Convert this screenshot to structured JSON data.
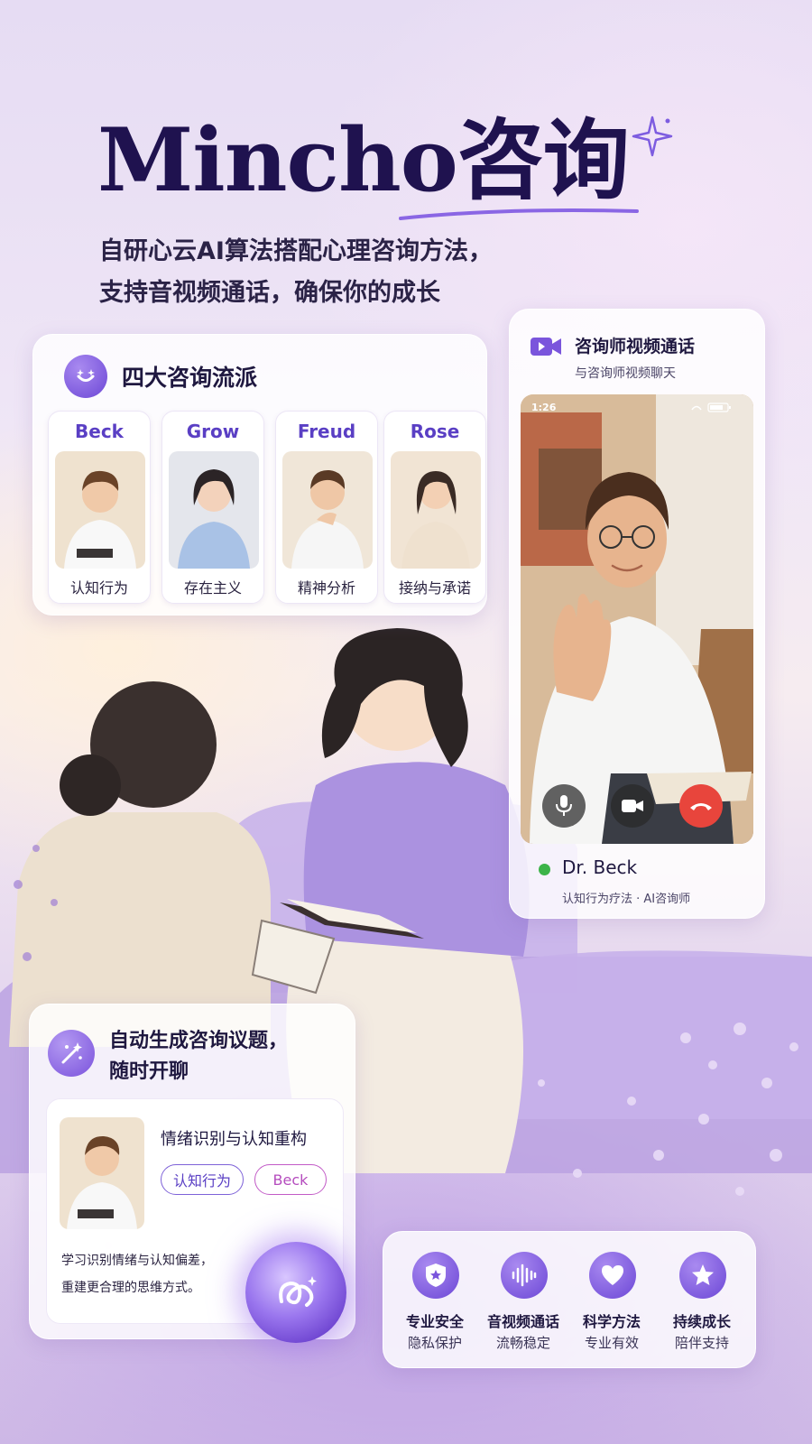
{
  "header": {
    "brand": "Mincho咨询",
    "subtitle_line1": "自研心云AI算法搭配心理咨询方法，",
    "subtitle_line2": "支持音视频通话，确保你的成长"
  },
  "schools": {
    "title": "四大咨询流派",
    "items": [
      {
        "name": "Beck",
        "tag": "认知行为"
      },
      {
        "name": "Grow",
        "tag": "存在主义"
      },
      {
        "name": "Freud",
        "tag": "精神分析"
      },
      {
        "name": "Rose",
        "tag": "接纳与承诺"
      }
    ]
  },
  "video_call": {
    "title": "咨询师视频通话",
    "subtitle": "与咨询师视频聊天",
    "status_time": "1:26",
    "doctor_name": "Dr. Beck",
    "doctor_role": "认知行为疗法 · AI咨询师",
    "online_color": "#3cb449"
  },
  "topics": {
    "title_line1": "自动生成咨询议题，",
    "title_line2": "随时开聊",
    "topic_name": "情绪识别与认知重构",
    "tag1": "认知行为",
    "tag2": "Beck",
    "desc_line1": "学习识别情绪与认知偏差，",
    "desc_line2": "重建更合理的思维方式。"
  },
  "features": [
    {
      "icon": "shield-star-icon",
      "title": "专业安全",
      "sub": "隐私保护"
    },
    {
      "icon": "sound-wave-icon",
      "title": "音视频通话",
      "sub": "流畅稳定"
    },
    {
      "icon": "heart-icon",
      "title": "科学方法",
      "sub": "专业有效"
    },
    {
      "icon": "star-icon",
      "title": "持续成长",
      "sub": "陪伴支持"
    }
  ],
  "colors": {
    "brand_text": "#1f124f",
    "accent_purple": "#6c47d6",
    "call_end_red": "#e8453c"
  }
}
